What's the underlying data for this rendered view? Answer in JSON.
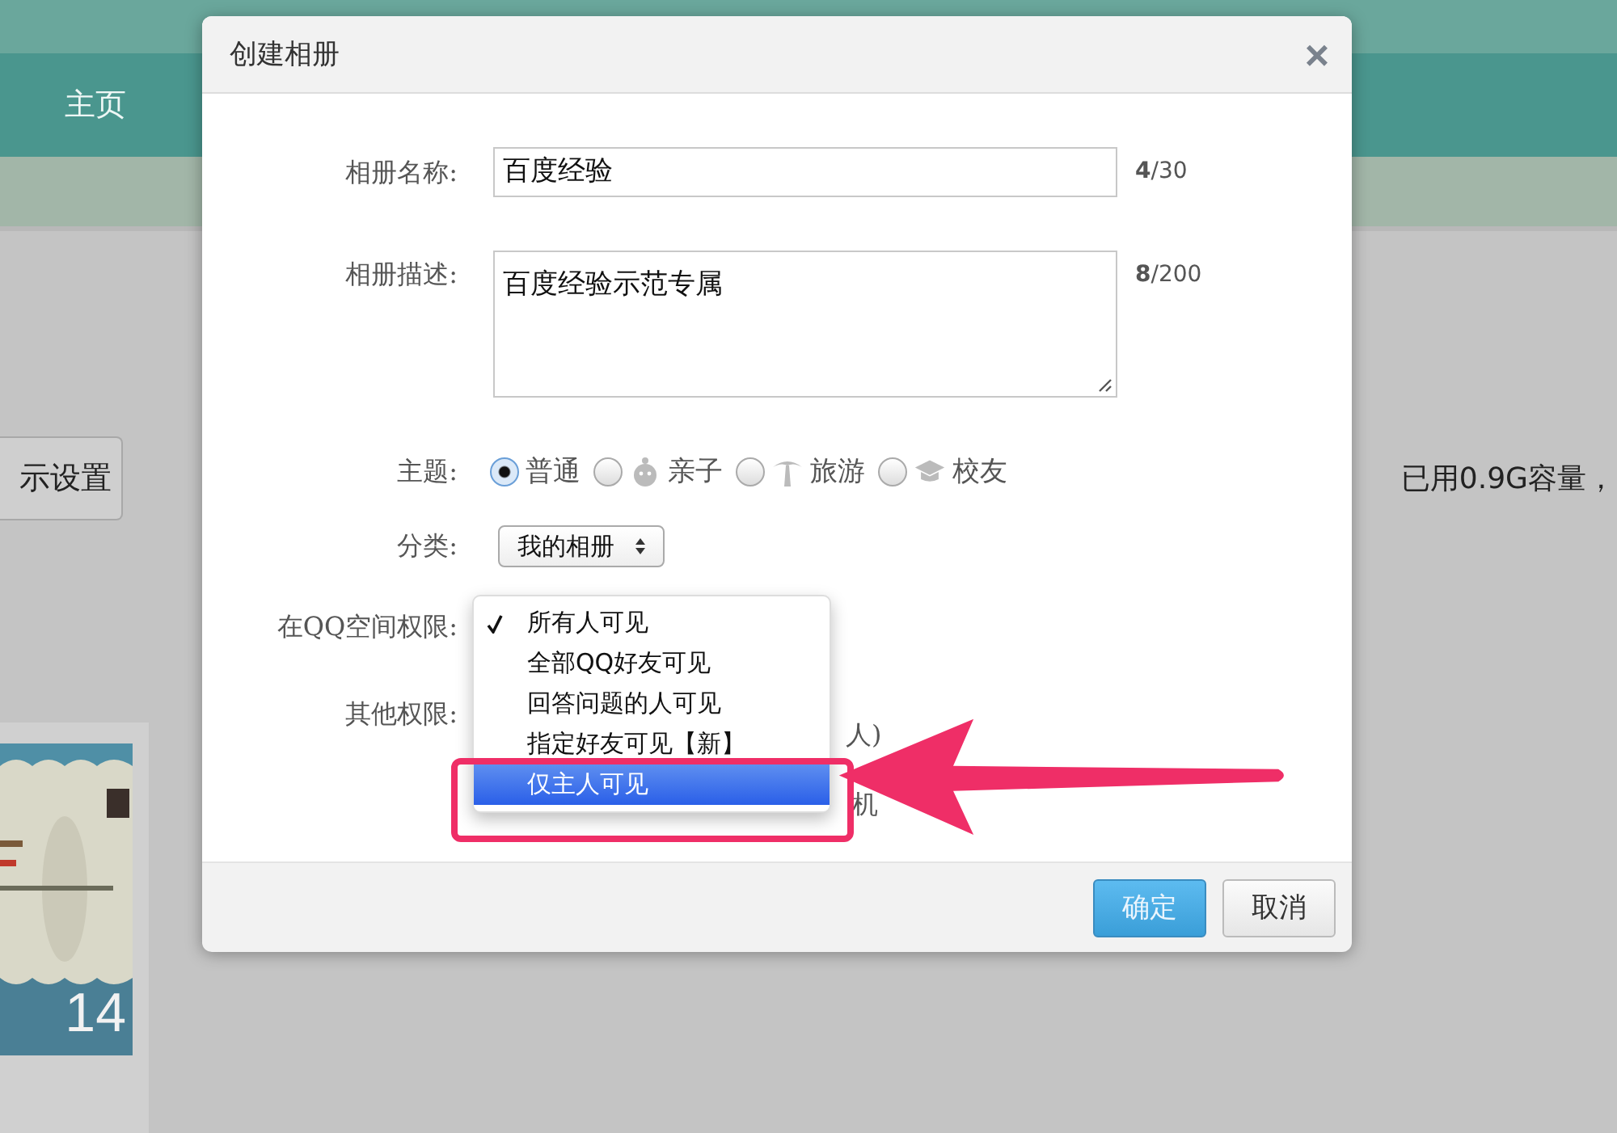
{
  "page": {
    "nav": [
      {
        "label": "主页",
        "selected": true
      }
    ],
    "settings_button": "示设置",
    "storage": "已用0.9G容量，",
    "album": {
      "kind": "picture",
      "count": "14"
    }
  },
  "dialog": {
    "title": "创建相册",
    "close": "×",
    "name": {
      "label": "相册名称:",
      "value": "百度经验",
      "count": "4",
      "max": "/30"
    },
    "description": {
      "label": "相册描述:",
      "value": "百度经验示范专属",
      "count": "8",
      "max": "/200"
    },
    "theme": {
      "label": "主题:",
      "options": [
        {
          "label": "普通",
          "kind": "plain",
          "selected": true
        },
        {
          "label": "亲子",
          "kind": "child",
          "selected": false
        },
        {
          "label": "旅游",
          "kind": "palm",
          "selected": false
        },
        {
          "label": "校友",
          "kind": "cap",
          "selected": false
        }
      ]
    },
    "category": {
      "label": "分类:",
      "value": "我的相册"
    },
    "qq_permission": {
      "label": "在QQ空间权限:",
      "options": [
        {
          "label": "所有人可见",
          "checked": true,
          "selected": false
        },
        {
          "label": "全部QQ好友可见",
          "checked": false,
          "selected": false
        },
        {
          "label": "回答问题的人可见",
          "checked": false,
          "selected": false
        },
        {
          "label": "指定好友可见【新】",
          "checked": false,
          "selected": false
        },
        {
          "label": "仅主人可见",
          "checked": false,
          "selected": true
        }
      ]
    },
    "other_permission": {
      "label": "其他权限:",
      "fragments": [
        "人)",
        "机"
      ]
    },
    "buttons": [
      {
        "label": "确定",
        "kind": "primary"
      },
      {
        "label": "取消",
        "kind": "secondary"
      }
    ]
  }
}
